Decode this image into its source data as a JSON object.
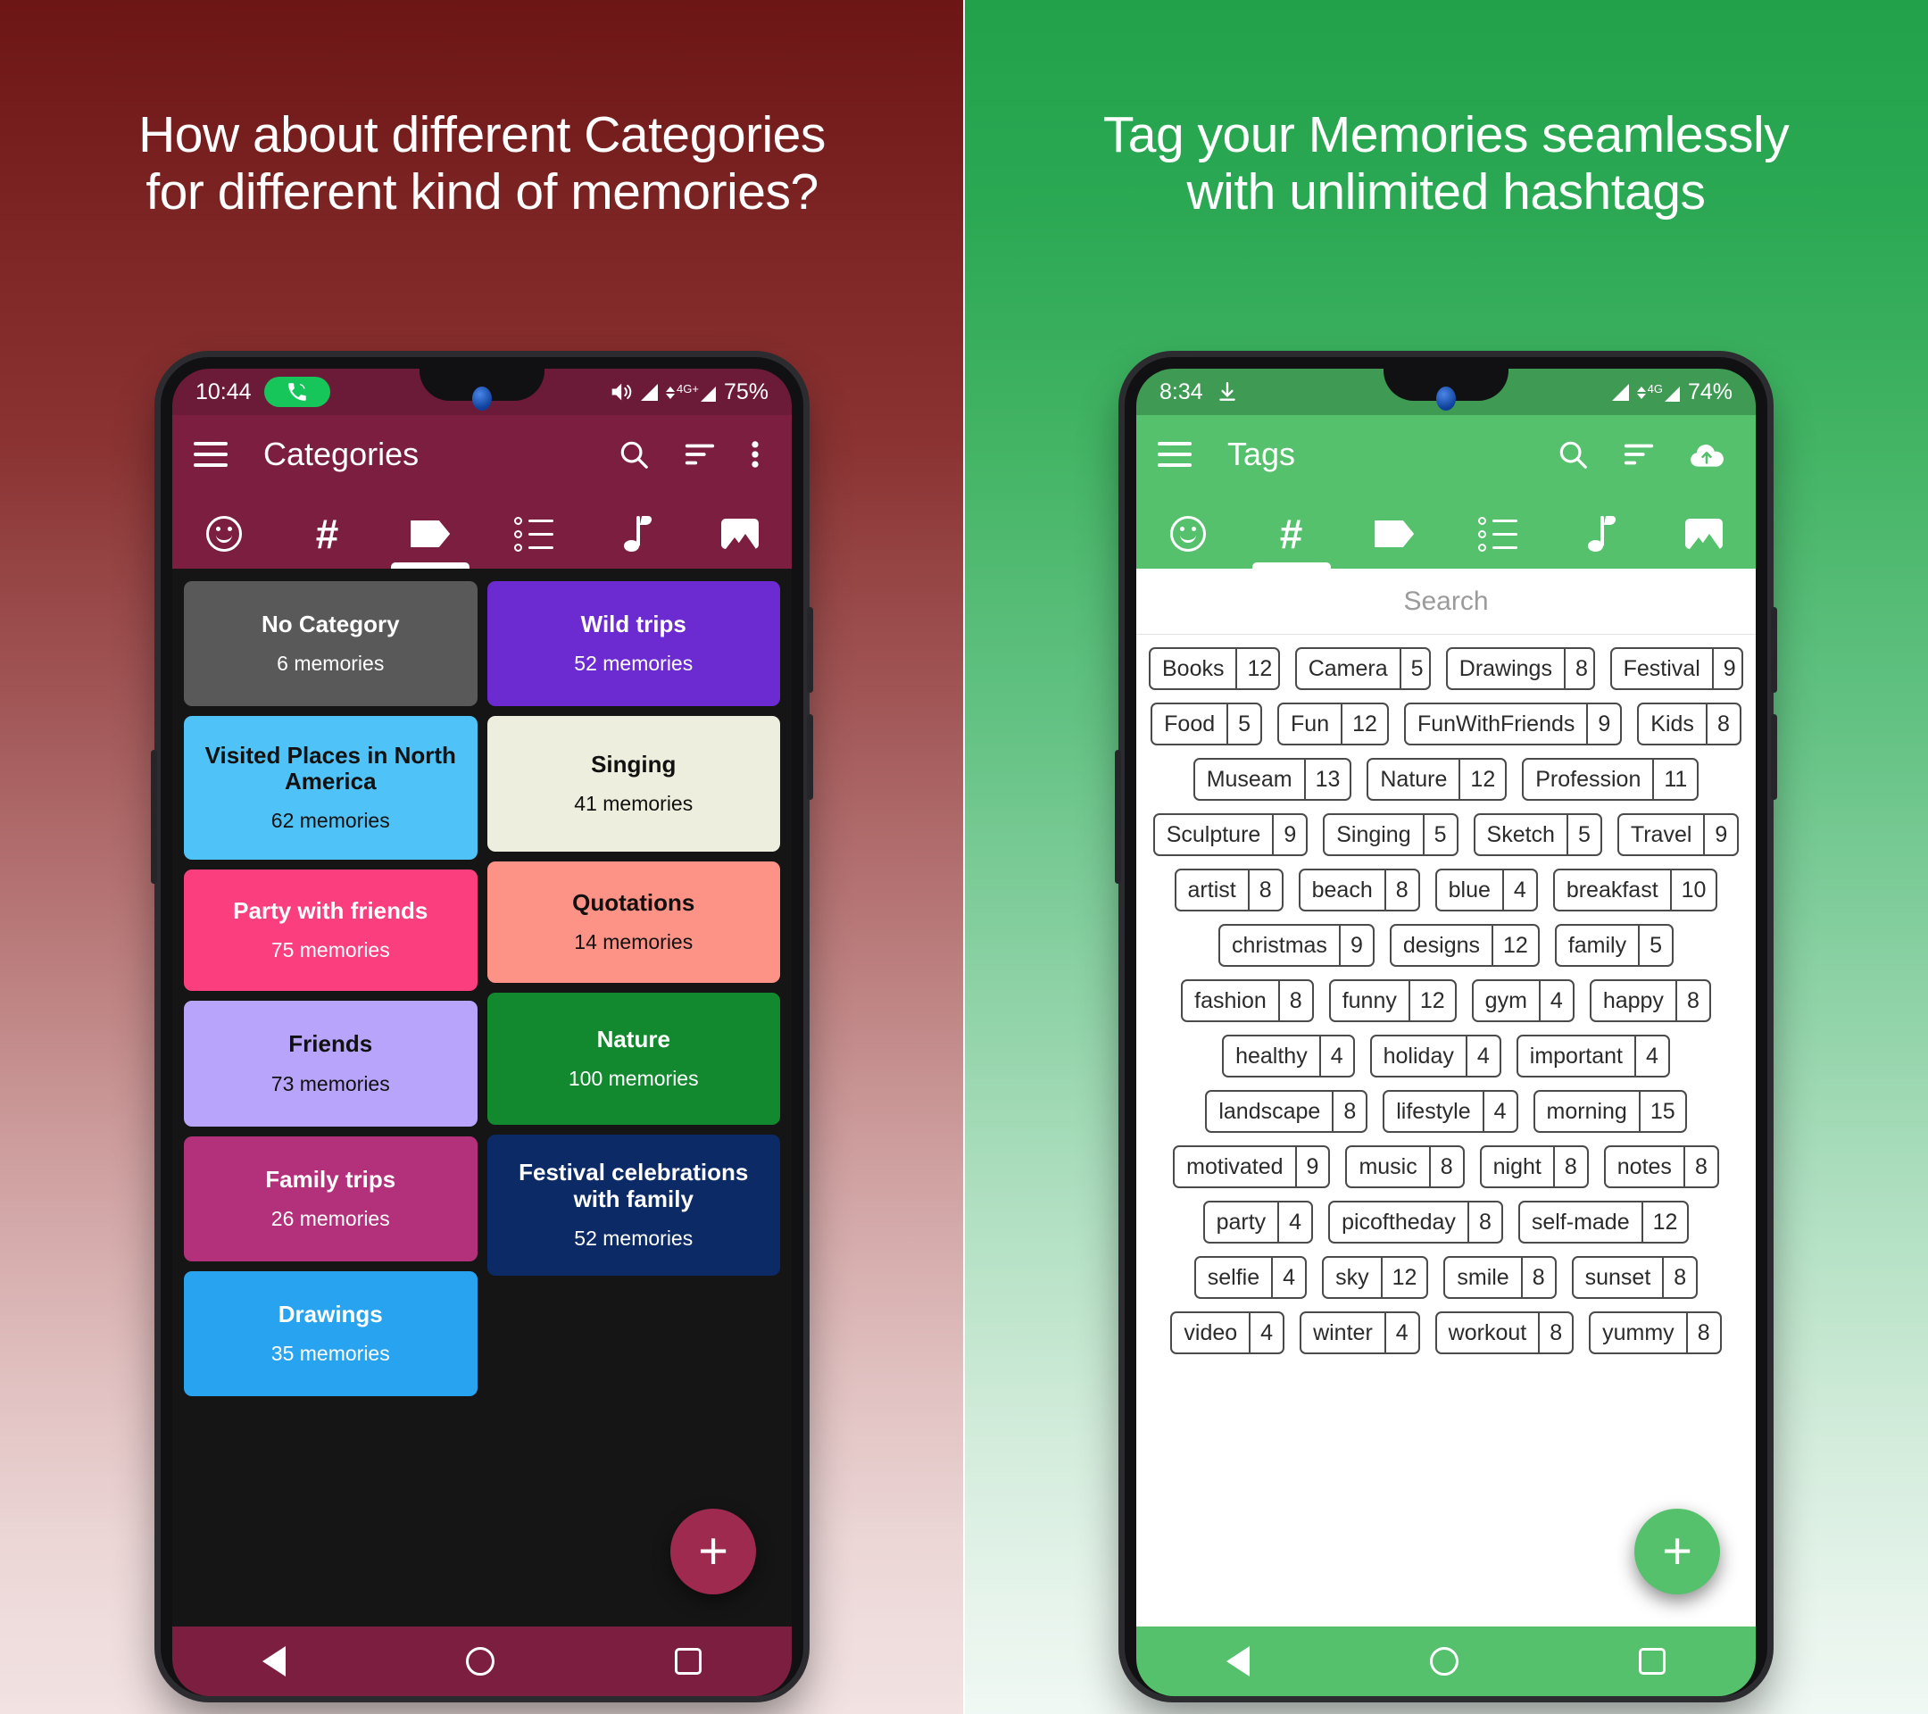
{
  "theme": {
    "left_bg_top": "#6d1616",
    "left_app_bar": "#7b1e3f",
    "left_status_bar": "#6b1a37",
    "left_accent": "#9e2a50",
    "right_bg_top": "#22a14a",
    "right_app_bar": "#55c16c",
    "right_status_bar": "#3f9a54",
    "right_accent": "#55c16c"
  },
  "left": {
    "headline_line1": "How about different Categories",
    "headline_line2": "for different kind of memories?",
    "status": {
      "time": "10:44",
      "call_icon": "phone-in-call-icon",
      "volume_icon": "volume-icon",
      "signal_icon": "signal-icon",
      "network_label": "4G+",
      "battery": "75%"
    },
    "appbar": {
      "menu_icon": "hamburger-menu-icon",
      "title": "Categories",
      "search_icon": "search-icon",
      "sort_icon": "sort-icon",
      "overflow_icon": "more-vertical-icon"
    },
    "tabs": [
      {
        "icon": "emoji-icon",
        "selected": false
      },
      {
        "icon": "hashtag-icon",
        "selected": false
      },
      {
        "icon": "tag-icon",
        "selected": true
      },
      {
        "icon": "list-icon",
        "selected": false
      },
      {
        "icon": "music-note-icon",
        "selected": false
      },
      {
        "icon": "image-icon",
        "selected": false
      }
    ],
    "columns": [
      [
        {
          "name": "No Category",
          "count": "6 memories",
          "bg": "#595959",
          "fg": "#ffffff",
          "pad": 34
        },
        {
          "name": "Visited Places in North America",
          "count": "62 memories",
          "bg": "#4fc3f7",
          "fg": "#111111",
          "pad": 30
        },
        {
          "name": "Party with friends",
          "count": "75 memories",
          "bg": "#fa3e7e",
          "fg": "#ffffff",
          "pad": 32
        },
        {
          "name": "Friends",
          "count": "73 memories",
          "bg": "#b8a5fb",
          "fg": "#111111",
          "pad": 34
        },
        {
          "name": "Family trips",
          "count": "26 memories",
          "bg": "#b3307a",
          "fg": "#ffffff",
          "pad": 34
        },
        {
          "name": "Drawings",
          "count": "35 memories",
          "bg": "#27a3ef",
          "fg": "#ffffff",
          "pad": 34
        }
      ],
      [
        {
          "name": "Wild trips",
          "count": "52 memories",
          "bg": "#6b2bd0",
          "fg": "#ffffff",
          "pad": 34
        },
        {
          "name": "Singing",
          "count": "41 memories",
          "bg": "#edeedd",
          "fg": "#111111",
          "pad": 40
        },
        {
          "name": "Quotations",
          "count": "14 memories",
          "bg": "#fd9286",
          "fg": "#111111",
          "pad": 32
        },
        {
          "name": "Nature",
          "count": "100 memories",
          "bg": "#13892f",
          "fg": "#ffffff",
          "pad": 38
        },
        {
          "name": "Festival celebrations with family",
          "count": "52 memories",
          "bg": "#0b2a66",
          "fg": "#ffffff",
          "pad": 28
        }
      ]
    ],
    "fab_label": "+",
    "nav": {
      "back_icon": "nav-back-icon",
      "home_icon": "nav-home-icon",
      "recents_icon": "nav-recents-icon"
    }
  },
  "right": {
    "headline_line1": "Tag your Memories seamlessly",
    "headline_line2": "with unlimited hashtags",
    "status": {
      "time": "8:34",
      "download_icon": "download-icon",
      "signal_icon": "signal-icon",
      "network_label": "4G",
      "battery": "74%"
    },
    "appbar": {
      "menu_icon": "hamburger-menu-icon",
      "title": "Tags",
      "search_icon": "search-icon",
      "sort_icon": "sort-icon",
      "cloud_icon": "cloud-upload-icon"
    },
    "tabs": [
      {
        "icon": "emoji-icon",
        "selected": false
      },
      {
        "icon": "hashtag-icon",
        "selected": true
      },
      {
        "icon": "tag-icon",
        "selected": false
      },
      {
        "icon": "list-icon",
        "selected": false
      },
      {
        "icon": "music-note-icon",
        "selected": false
      },
      {
        "icon": "image-icon",
        "selected": false
      }
    ],
    "search_placeholder": "Search",
    "tag_rows": [
      [
        {
          "label": "Books",
          "count": "12"
        },
        {
          "label": "Camera",
          "count": "5"
        },
        {
          "label": "Drawings",
          "count": "8"
        },
        {
          "label": "Festival",
          "count": "9"
        }
      ],
      [
        {
          "label": "Food",
          "count": "5"
        },
        {
          "label": "Fun",
          "count": "12"
        },
        {
          "label": "FunWithFriends",
          "count": "9"
        },
        {
          "label": "Kids",
          "count": "8"
        }
      ],
      [
        {
          "label": "Museam",
          "count": "13"
        },
        {
          "label": "Nature",
          "count": "12"
        },
        {
          "label": "Profession",
          "count": "11"
        }
      ],
      [
        {
          "label": "Sculpture",
          "count": "9"
        },
        {
          "label": "Singing",
          "count": "5"
        },
        {
          "label": "Sketch",
          "count": "5"
        },
        {
          "label": "Travel",
          "count": "9"
        }
      ],
      [
        {
          "label": "artist",
          "count": "8"
        },
        {
          "label": "beach",
          "count": "8"
        },
        {
          "label": "blue",
          "count": "4"
        },
        {
          "label": "breakfast",
          "count": "10"
        }
      ],
      [
        {
          "label": "christmas",
          "count": "9"
        },
        {
          "label": "designs",
          "count": "12"
        },
        {
          "label": "family",
          "count": "5"
        }
      ],
      [
        {
          "label": "fashion",
          "count": "8"
        },
        {
          "label": "funny",
          "count": "12"
        },
        {
          "label": "gym",
          "count": "4"
        },
        {
          "label": "happy",
          "count": "8"
        }
      ],
      [
        {
          "label": "healthy",
          "count": "4"
        },
        {
          "label": "holiday",
          "count": "4"
        },
        {
          "label": "important",
          "count": "4"
        }
      ],
      [
        {
          "label": "landscape",
          "count": "8"
        },
        {
          "label": "lifestyle",
          "count": "4"
        },
        {
          "label": "morning",
          "count": "15"
        }
      ],
      [
        {
          "label": "motivated",
          "count": "9"
        },
        {
          "label": "music",
          "count": "8"
        },
        {
          "label": "night",
          "count": "8"
        },
        {
          "label": "notes",
          "count": "8"
        }
      ],
      [
        {
          "label": "party",
          "count": "4"
        },
        {
          "label": "picoftheday",
          "count": "8"
        },
        {
          "label": "self-made",
          "count": "12"
        }
      ],
      [
        {
          "label": "selfie",
          "count": "4"
        },
        {
          "label": "sky",
          "count": "12"
        },
        {
          "label": "smile",
          "count": "8"
        },
        {
          "label": "sunset",
          "count": "8"
        }
      ],
      [
        {
          "label": "video",
          "count": "4"
        },
        {
          "label": "winter",
          "count": "4"
        },
        {
          "label": "workout",
          "count": "8"
        },
        {
          "label": "yummy",
          "count": "8"
        }
      ]
    ],
    "fab_label": "+",
    "nav": {
      "back_icon": "nav-back-icon",
      "home_icon": "nav-home-icon",
      "recents_icon": "nav-recents-icon"
    }
  }
}
